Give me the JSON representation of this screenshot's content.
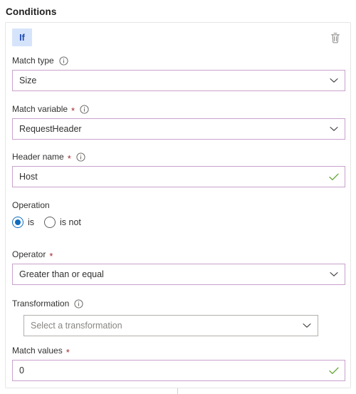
{
  "section": {
    "title": "Conditions"
  },
  "card": {
    "badge_label": "If",
    "delete_icon": "trash-icon",
    "accent_border_color": "#c9a2cd",
    "badge_bg_color": "#d6e4fb",
    "badge_text_color": "#1e49b5",
    "required_star_color": "#a4262c",
    "valid_check_color": "#5ba32b",
    "radio_selected_color": "#0f6cbd"
  },
  "fields": {
    "match_type": {
      "label": "Match type",
      "required": false,
      "info_icon": "info-icon",
      "control": "dropdown",
      "value": "Size",
      "chevron_icon": "chevron-down-icon"
    },
    "match_variable": {
      "label": "Match variable",
      "required": true,
      "required_marker": "*",
      "info_icon": "info-icon",
      "control": "dropdown",
      "value": "RequestHeader",
      "chevron_icon": "chevron-down-icon"
    },
    "header_name": {
      "label": "Header name",
      "required": true,
      "required_marker": "*",
      "info_icon": "info-icon",
      "control": "textbox",
      "value": "Host",
      "status_icon": "checkmark-icon"
    },
    "operation": {
      "label": "Operation",
      "required": false,
      "options": [
        {
          "label": "is",
          "selected": true
        },
        {
          "label": "is not",
          "selected": false
        }
      ]
    },
    "operator": {
      "label": "Operator",
      "required": true,
      "required_marker": "*",
      "control": "dropdown",
      "value": "Greater than or equal",
      "chevron_icon": "chevron-down-icon"
    },
    "transformation": {
      "label": "Transformation",
      "required": false,
      "info_icon": "info-icon",
      "control": "dropdown",
      "value": "",
      "placeholder": "Select a transformation",
      "chevron_icon": "chevron-down-icon"
    },
    "match_values": {
      "label": "Match values",
      "required": true,
      "required_marker": "*",
      "control": "textbox",
      "value": "0",
      "status_icon": "checkmark-icon"
    }
  }
}
